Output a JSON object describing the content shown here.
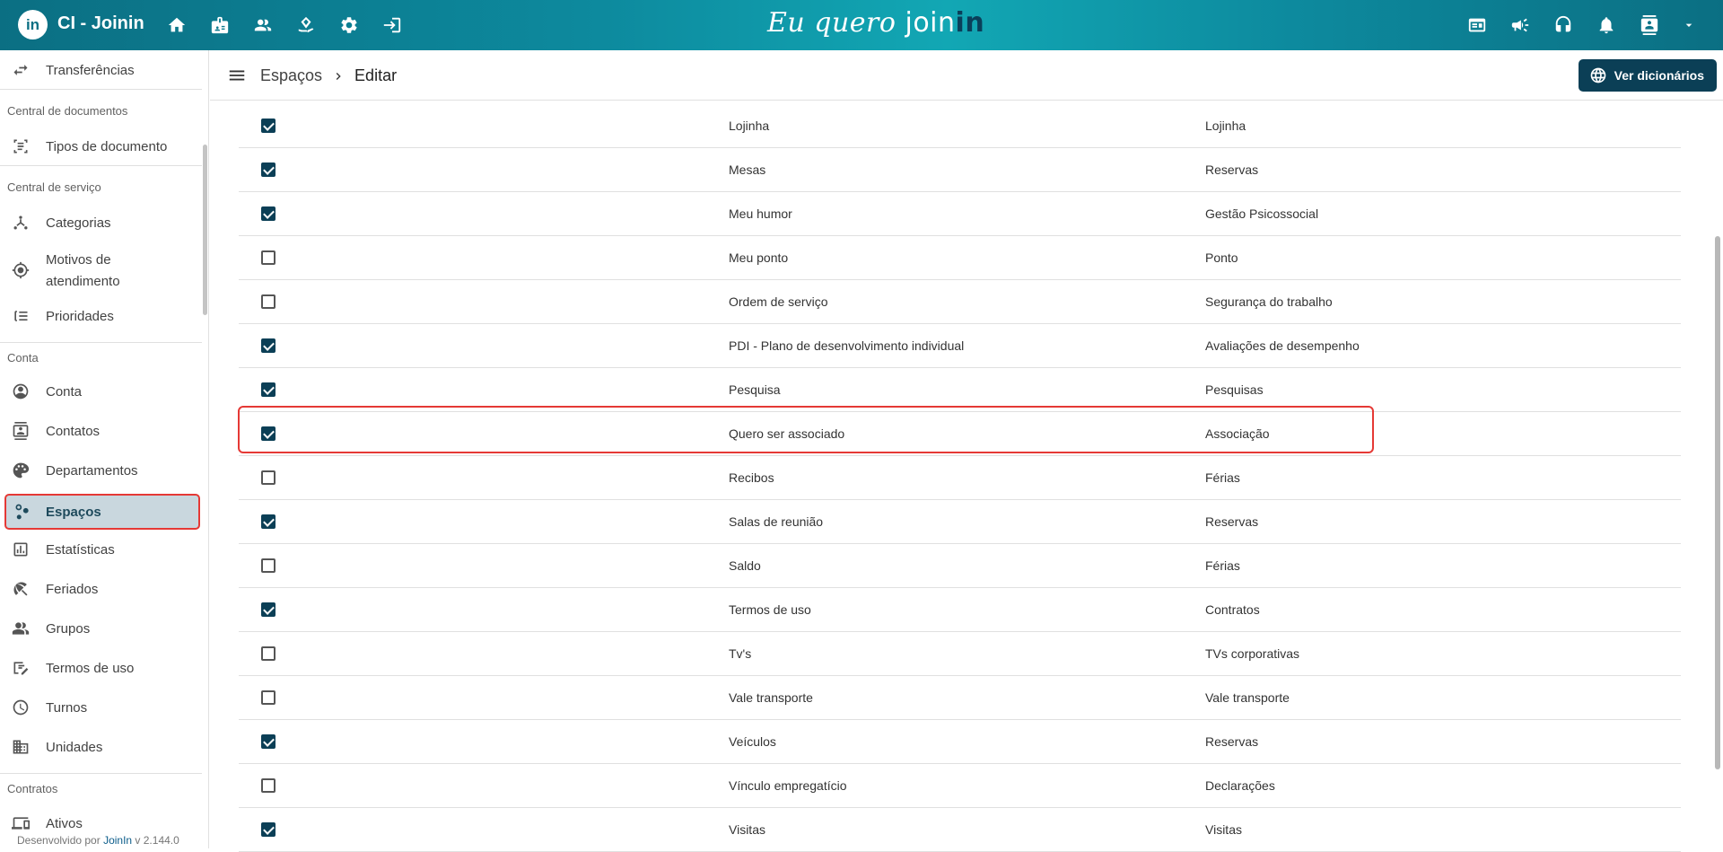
{
  "app": {
    "logo_text": "in",
    "title": "CI - Joinin"
  },
  "brand": {
    "prefix": "Eu quero ",
    "join": "join",
    "in": "in"
  },
  "top_nav_icons": [
    "home-icon",
    "badge-icon",
    "people-icon",
    "diamond-hand-icon",
    "gear-icon",
    "login-icon"
  ],
  "top_right_icons": [
    "id-card-icon",
    "megaphone-icon",
    "headset-icon",
    "bell-icon",
    "contact-icon",
    "chevron-down-icon"
  ],
  "sidebar": {
    "transferencias": "Transferências",
    "sec_documentos": "Central de documentos",
    "tipos_documento": "Tipos de documento",
    "sec_servico": "Central de serviço",
    "categorias": "Categorias",
    "motivos_1": "Motivos de",
    "motivos_2": "atendimento",
    "prioridades": "Prioridades",
    "sec_conta": "Conta",
    "conta": "Conta",
    "contatos": "Contatos",
    "departamentos": "Departamentos",
    "espacos": "Espaços",
    "estatisticas": "Estatísticas",
    "feriados": "Feriados",
    "grupos": "Grupos",
    "termos_uso": "Termos de uso",
    "turnos": "Turnos",
    "unidades": "Unidades",
    "sec_contratos": "Contratos",
    "ativos": "Ativos",
    "footer_prefix": "Desenvolvido por ",
    "footer_link": "JoinIn",
    "footer_version": " v 2.144.0"
  },
  "header": {
    "crumb_parent": "Espaços",
    "crumb_current": "Editar",
    "dict_button": "Ver dicionários"
  },
  "rows": [
    {
      "checked": true,
      "name": "Lojinha",
      "category": "Lojinha"
    },
    {
      "checked": true,
      "name": "Mesas",
      "category": "Reservas"
    },
    {
      "checked": true,
      "name": "Meu humor",
      "category": "Gestão Psicossocial"
    },
    {
      "checked": false,
      "name": "Meu ponto",
      "category": "Ponto"
    },
    {
      "checked": false,
      "name": "Ordem de serviço",
      "category": "Segurança do trabalho"
    },
    {
      "checked": true,
      "name": "PDI - Plano de desenvolvimento individual",
      "category": "Avaliações de desempenho"
    },
    {
      "checked": true,
      "name": "Pesquisa",
      "category": "Pesquisas"
    },
    {
      "checked": true,
      "name": "Quero ser associado",
      "category": "Associação"
    },
    {
      "checked": false,
      "name": "Recibos",
      "category": "Férias"
    },
    {
      "checked": true,
      "name": "Salas de reunião",
      "category": "Reservas"
    },
    {
      "checked": false,
      "name": "Saldo",
      "category": "Férias"
    },
    {
      "checked": true,
      "name": "Termos de uso",
      "category": "Contratos"
    },
    {
      "checked": false,
      "name": "Tv's",
      "category": "TVs corporativas"
    },
    {
      "checked": false,
      "name": "Vale transporte",
      "category": "Vale transporte"
    },
    {
      "checked": true,
      "name": "Veículos",
      "category": "Reservas"
    },
    {
      "checked": false,
      "name": "Vínculo empregatício",
      "category": "Declarações"
    },
    {
      "checked": true,
      "name": "Visitas",
      "category": "Visitas"
    }
  ],
  "colors": {
    "primary": "#0b3f56",
    "highlight": "#e53935",
    "topbar": "#0d8a9e"
  }
}
